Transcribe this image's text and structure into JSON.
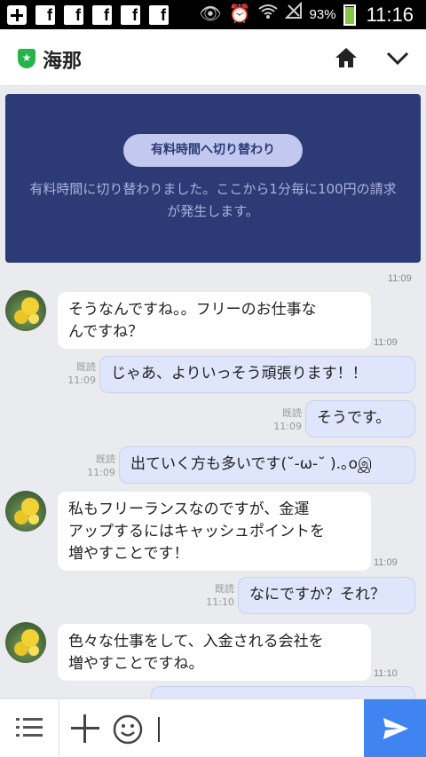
{
  "status_bar": {
    "battery": "93%",
    "battery_level": 0.93,
    "clock": "11:16",
    "icons": [
      "plus-square-icon",
      "facebook-icon",
      "facebook-icon",
      "facebook-icon",
      "facebook-icon",
      "facebook-icon",
      "eye-icon",
      "alarm-icon",
      "wifi-icon",
      "no-signal-icon",
      "battery-icon"
    ]
  },
  "header": {
    "title": "海那"
  },
  "notice": {
    "pill": "有料時間へ切り替わり",
    "text": "有料時間に切り替わりました。ここから1分毎に100円の請求が発生します。",
    "time": "11:09"
  },
  "messages": [
    {
      "dir": "in",
      "lines": [
        "そうなんですね。。フリーのお仕事な",
        "んですね？"
      ],
      "time": "11:09"
    },
    {
      "dir": "out",
      "text": "じゃあ、よりいっそう頑張ります！！",
      "read": "既読",
      "time": "11:09"
    },
    {
      "dir": "out",
      "text": "そうです。",
      "read": "既読",
      "time": "11:09"
    },
    {
      "dir": "out",
      "text": "出ていく方も多いです(˘-ω-˘ ).｡oஇ",
      "read": "既読",
      "time": "11:09"
    },
    {
      "dir": "in",
      "lines": [
        "私もフリーランスなのですが、金運",
        "アップするにはキャッシュポイントを",
        "増やすことです！"
      ],
      "time": "11:09"
    },
    {
      "dir": "out",
      "text": "なにですか？それ？",
      "read": "既読",
      "time": "11:10"
    },
    {
      "dir": "in",
      "lines": [
        "色々な仕事をして、入金される会社を",
        "増やすことですね。"
      ],
      "time": "11:10"
    }
  ],
  "colors": {
    "notice_bg": "#2c3a75",
    "outgoing_bubble": "#dfe5fb",
    "send_button": "#3f84f1",
    "shield": "#27b44a"
  }
}
